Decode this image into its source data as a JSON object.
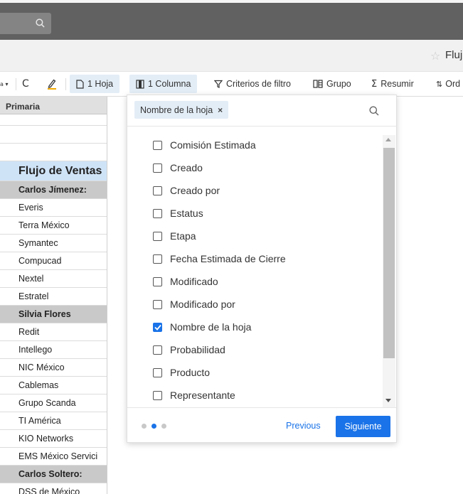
{
  "header": {
    "doc_title": "Fluj"
  },
  "toolbar": {
    "sheet_label": "1 Hoja",
    "column_label": "1 Columna",
    "filter_label": "Criterios de filtro",
    "group_label": "Grupo",
    "summary_label": "Resumir",
    "sort_label": "Ord"
  },
  "grid": {
    "header": "Primaria",
    "title_row": "Flujo de Ventas",
    "groups": [
      {
        "name": "Carlos Jímenez:",
        "rows": [
          "Everis",
          "Terra México",
          "Symantec",
          "Compucad",
          "Nextel",
          "Estratel"
        ]
      },
      {
        "name": "Silvia Flores",
        "rows": [
          "Redit",
          "Intellego",
          "NIC México",
          "Cablemas",
          "Grupo Scanda",
          "TI América",
          "KIO Networks",
          "EMS México Servici"
        ]
      },
      {
        "name": "Carlos Soltero:",
        "rows": [
          "DSS de México"
        ]
      }
    ]
  },
  "panel": {
    "chip_label": "Nombre de la hoja",
    "chip_remove": "×",
    "options": [
      {
        "label": "Comisión Estimada",
        "checked": false
      },
      {
        "label": "Creado",
        "checked": false
      },
      {
        "label": "Creado por",
        "checked": false
      },
      {
        "label": "Estatus",
        "checked": false
      },
      {
        "label": "Etapa",
        "checked": false
      },
      {
        "label": "Fecha Estimada de Cierre",
        "checked": false
      },
      {
        "label": "Modificado",
        "checked": false
      },
      {
        "label": "Modificado por",
        "checked": false
      },
      {
        "label": "Nombre de la hoja",
        "checked": true
      },
      {
        "label": "Probabilidad",
        "checked": false
      },
      {
        "label": "Producto",
        "checked": false
      },
      {
        "label": "Representante",
        "checked": false
      }
    ],
    "previous_label": "Previous",
    "next_label": "Siguiente",
    "page_step": 2,
    "page_total": 3
  },
  "colors": {
    "accent": "#1a73e8",
    "topbar": "#616161",
    "chip_bg": "#e3edf6",
    "title_row_bg": "#cfe3f7",
    "group_row_bg": "#c9c9c9"
  }
}
